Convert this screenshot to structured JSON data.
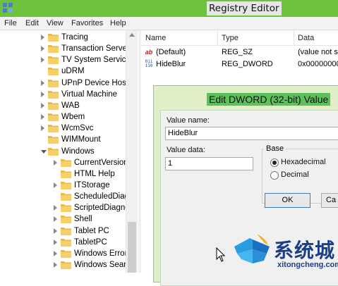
{
  "window": {
    "title": "Registry Editor",
    "accent_color": "#6fc23d",
    "icon": "registry-editor-icon"
  },
  "menu": [
    "File",
    "Edit",
    "View",
    "Favorites",
    "Help"
  ],
  "tree": {
    "items": [
      {
        "label": "Tracing",
        "expander": "collapsed"
      },
      {
        "label": "Transaction Server",
        "expander": "collapsed"
      },
      {
        "label": "TV System Services",
        "expander": "collapsed"
      },
      {
        "label": "uDRM",
        "expander": "none"
      },
      {
        "label": "UPnP Device Host",
        "expander": "collapsed"
      },
      {
        "label": "Virtual Machine",
        "expander": "collapsed"
      },
      {
        "label": "WAB",
        "expander": "collapsed"
      },
      {
        "label": "Wbem",
        "expander": "collapsed"
      },
      {
        "label": "WcmSvc",
        "expander": "collapsed"
      },
      {
        "label": "WIMMount",
        "expander": "none"
      },
      {
        "label": "Windows",
        "expander": "expanded"
      },
      {
        "label": "CurrentVersion",
        "expander": "collapsed"
      },
      {
        "label": "HTML Help",
        "expander": "none"
      },
      {
        "label": "ITStorage",
        "expander": "collapsed"
      },
      {
        "label": "ScheduledDiagr",
        "expander": "none"
      },
      {
        "label": "ScriptedDiagnos",
        "expander": "collapsed"
      },
      {
        "label": "Shell",
        "expander": "collapsed"
      },
      {
        "label": "Tablet PC",
        "expander": "collapsed"
      },
      {
        "label": "TabletPC",
        "expander": "collapsed"
      },
      {
        "label": "Windows Error F",
        "expander": "collapsed"
      },
      {
        "label": "Windows Search",
        "expander": "collapsed"
      }
    ]
  },
  "list": {
    "columns": [
      "Name",
      "Type",
      "Data"
    ],
    "rows": [
      {
        "name": "(Default)",
        "type": "REG_SZ",
        "data": "(value not se",
        "icon": "string-value-icon"
      },
      {
        "name": "HideBlur",
        "type": "REG_DWORD",
        "data": "0x00000000",
        "icon": "binary-value-icon"
      }
    ]
  },
  "dialog": {
    "title": "Edit DWORD (32-bit) Value",
    "value_name_label": "Value name:",
    "value_name": "HideBlur",
    "value_data_label": "Value data:",
    "value_data": "1",
    "base_label": "Base",
    "base_options": [
      "Hexadecimal",
      "Decimal"
    ],
    "selected_base": "Hexadecimal",
    "ok_label": "OK",
    "cancel_label": "Ca"
  },
  "watermark": {
    "text": "系统城",
    "url_text": "xitongcheng.com"
  }
}
